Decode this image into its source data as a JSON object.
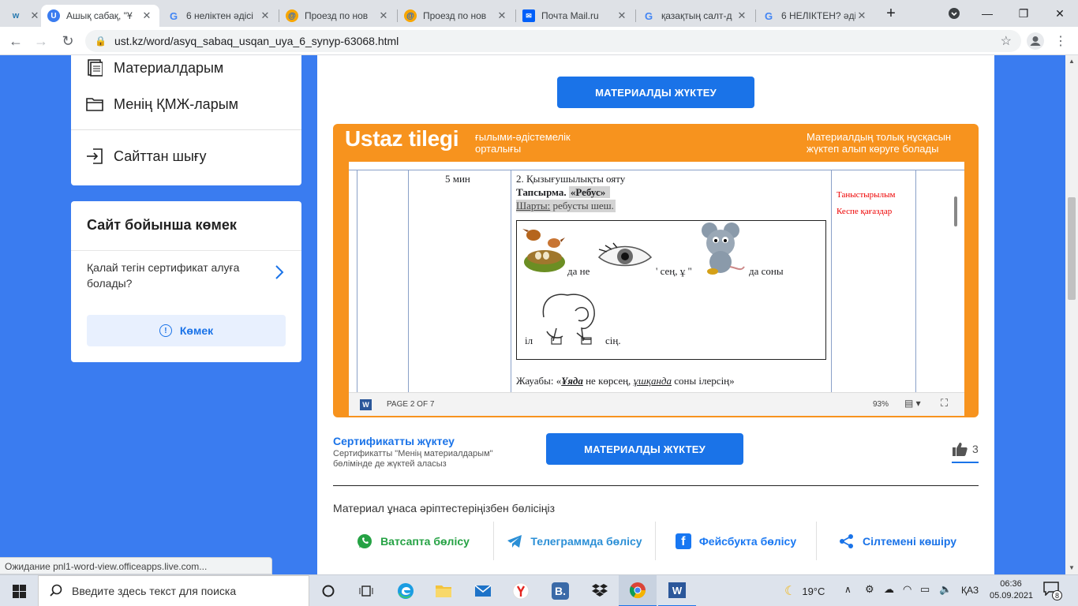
{
  "browser": {
    "tabs": [
      {
        "title": "",
        "favicon": "ustaz-logo-icon",
        "active": false
      },
      {
        "title": "Ашық сабақ, \"Ұ",
        "favicon": "ustaz-u-icon",
        "active": true
      },
      {
        "title": "6 неліктен әдісі",
        "favicon": "google-icon",
        "active": false
      },
      {
        "title": "Проезд по нов",
        "favicon": "mail-at-icon",
        "active": false
      },
      {
        "title": "Проезд по нов",
        "favicon": "mail-at-icon",
        "active": false
      },
      {
        "title": "Почта Mail.ru",
        "favicon": "mailru-icon",
        "active": false
      },
      {
        "title": "қазақтың салт-д",
        "favicon": "google-icon",
        "active": false
      },
      {
        "title": "6 НЕЛІКТЕН? әді",
        "favicon": "google-icon",
        "active": false
      }
    ],
    "new_tab_label": "+",
    "url": "ust.kz/word/asyq_sabaq_usqan_uya_6_synyp-63068.html"
  },
  "sidebar": {
    "menu": [
      {
        "label": "Материалдарым",
        "icon": "document-icon"
      },
      {
        "label": "Менің ҚМЖ-ларым",
        "icon": "folder-icon"
      }
    ],
    "logout_label": "Сайттан шығу",
    "help": {
      "title": "Сайт бойынша көмек",
      "question": "Қалай тегін сертификат алуға болады?",
      "button": "Көмек"
    }
  },
  "main": {
    "download_top": "МАТЕРИАЛДЫ ЖҮКТЕУ",
    "viewer": {
      "brand": "Ustaz tilegi",
      "brand_sub": "ғылыми-әдістемелік орталығы",
      "note": "Материалдың толық нұсқасын жүктеп алып көруге болады",
      "doc": {
        "time": "5 мин",
        "heading": "2. Қызығушылықты ояту",
        "task_label": "Тапсырма.",
        "task_title": "«Ребус»",
        "condition_label": "Шарты:",
        "condition_text": " ребусты шеш.",
        "resources": [
          "Таныстырылым",
          "Кеспе қағаздар"
        ],
        "rebus_row1": [
          "да не",
          "' сең, ұ \"",
          "да соны"
        ],
        "rebus_row2_left": "іл",
        "rebus_row2_right": "сің.",
        "answer_prefix": "Жауабы: «",
        "answer_w1": "Ұяда",
        "answer_mid": " не көрсең, ",
        "answer_w2": "ұшқанда",
        "answer_end": " соны ілерсің»"
      },
      "status": {
        "page": "PAGE 2 OF 7",
        "zoom": "93%"
      }
    },
    "certificate": {
      "title": "Сертификатты жүктеу",
      "desc": "Сертификатты \"Менің материалдарым\" бөлімінде де жүктей аласыз"
    },
    "download_bottom": "МАТЕРИАЛДЫ ЖҮКТЕУ",
    "likes": "3",
    "share_title": "Материал ұнаса әріптестеріңізбен бөлісіңіз",
    "share_buttons": [
      {
        "label": "Ватсапта бөлісу",
        "icon": "whatsapp-icon",
        "color": "#25a244"
      },
      {
        "label": "Телеграммда бөлісу",
        "icon": "telegram-icon",
        "color": "#2b8fd6"
      },
      {
        "label": "Фейсбукта бөлісу",
        "icon": "facebook-icon",
        "color": "#1877f2"
      },
      {
        "label": "Сілтемені көшіру",
        "icon": "share-icon",
        "color": "#1a73e8"
      }
    ]
  },
  "status_bar": "Ожидание pnl1-word-view.officeapps.live.com...",
  "taskbar": {
    "search_placeholder": "Введите здесь текст для поиска",
    "weather": "19°C",
    "lang": "ҚАЗ",
    "time": "06:36",
    "date": "05.09.2021",
    "notifications": "8"
  },
  "colors": {
    "accent": "#1a73e8",
    "page_bg": "#3a7cf0",
    "viewer_orange": "#f7931e"
  }
}
